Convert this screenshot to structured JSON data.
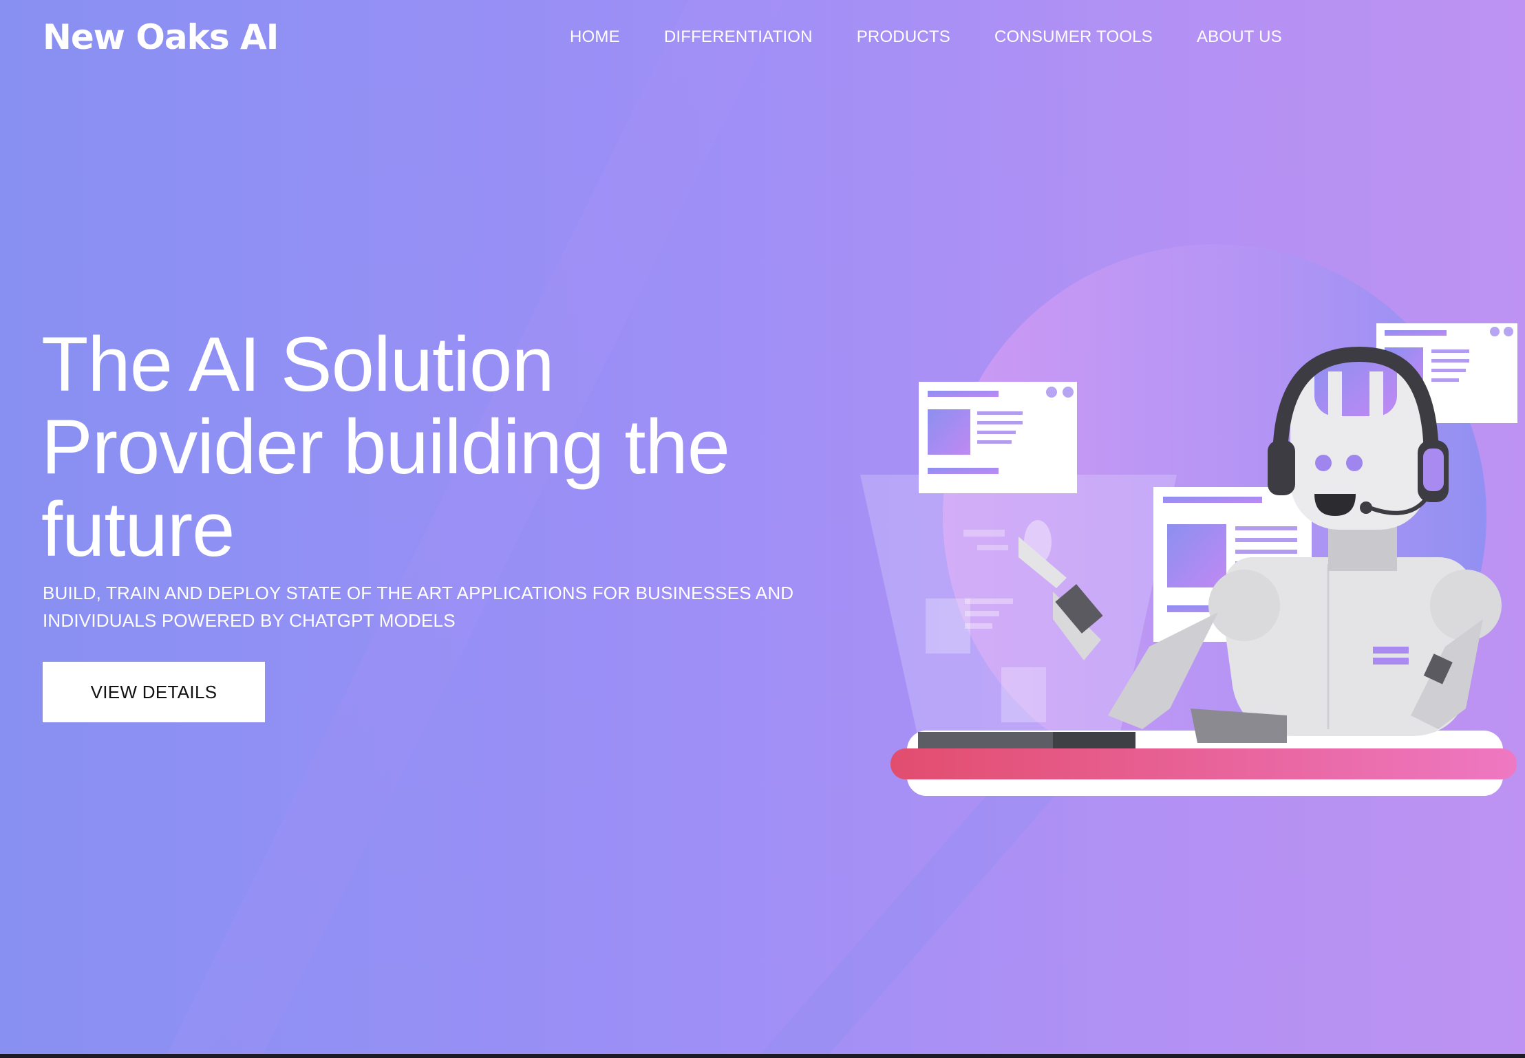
{
  "brand": {
    "logo_text": "New Oaks AI"
  },
  "nav": {
    "items": [
      {
        "label": "HOME"
      },
      {
        "label": "DIFFERENTIATION"
      },
      {
        "label": "PRODUCTS"
      },
      {
        "label": "CONSUMER TOOLS"
      },
      {
        "label": "ABOUT US"
      }
    ]
  },
  "hero": {
    "title": "The AI Solution Provider building the future",
    "subtitle": "BUILD, TRAIN AND DEPLOY STATE OF THE ART APPLICATIONS FOR BUSINESSES AND INDIVIDUALS POWERED BY CHATGPT MODELS",
    "cta_label": "VIEW DETAILS",
    "illustration_icon": "robot-with-headset-icon"
  },
  "colors": {
    "background_left": "#8890f2",
    "background_right": "#bd92f2",
    "text": "#ffffff",
    "button_bg": "#ffffff",
    "button_text": "#111111",
    "desk_accent": "#e85a8a"
  }
}
